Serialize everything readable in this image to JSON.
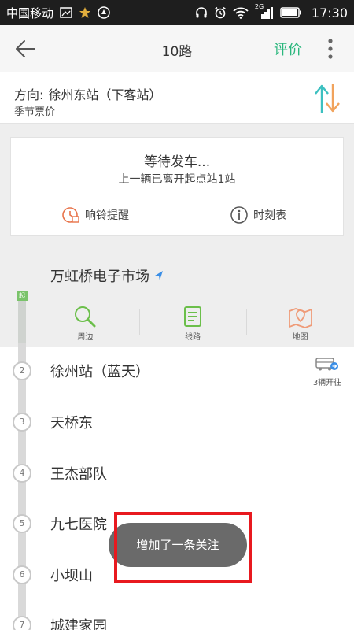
{
  "status_bar": {
    "carrier": "中国移动",
    "signal_badge": "2G",
    "time": "17:30"
  },
  "header": {
    "title": "10路",
    "rate_label": "评价"
  },
  "direction": {
    "label": "方向:",
    "value": "徐州东站（下客站）",
    "season_label": "季节票价"
  },
  "status_card": {
    "waiting": "等待发车...",
    "previous_bus": "上一辆已离开起点站1站",
    "ring_alert_label": "响铃提醒",
    "timetable_label": "时刻表"
  },
  "selected_station": {
    "name": "万虹桥电子市场",
    "start_tag": "起",
    "tools": [
      {
        "label": "周边",
        "icon": "magnifier-icon"
      },
      {
        "label": "线路",
        "icon": "route-doc-icon"
      },
      {
        "label": "地图",
        "icon": "map-pin-icon"
      }
    ]
  },
  "stops": [
    {
      "num": "2",
      "name": "徐州站（蓝天）",
      "bus_count": "3辆开往"
    },
    {
      "num": "3",
      "name": "天桥东"
    },
    {
      "num": "4",
      "name": "王杰部队"
    },
    {
      "num": "5",
      "name": "九七医院"
    },
    {
      "num": "6",
      "name": "小坝山"
    },
    {
      "num": "7",
      "name": "城建家园"
    }
  ],
  "toast": {
    "message": "增加了一条关注"
  },
  "colors": {
    "accent_green": "#2ab77d",
    "alert_orange": "#e8734a",
    "highlight_red": "#e8191f"
  }
}
